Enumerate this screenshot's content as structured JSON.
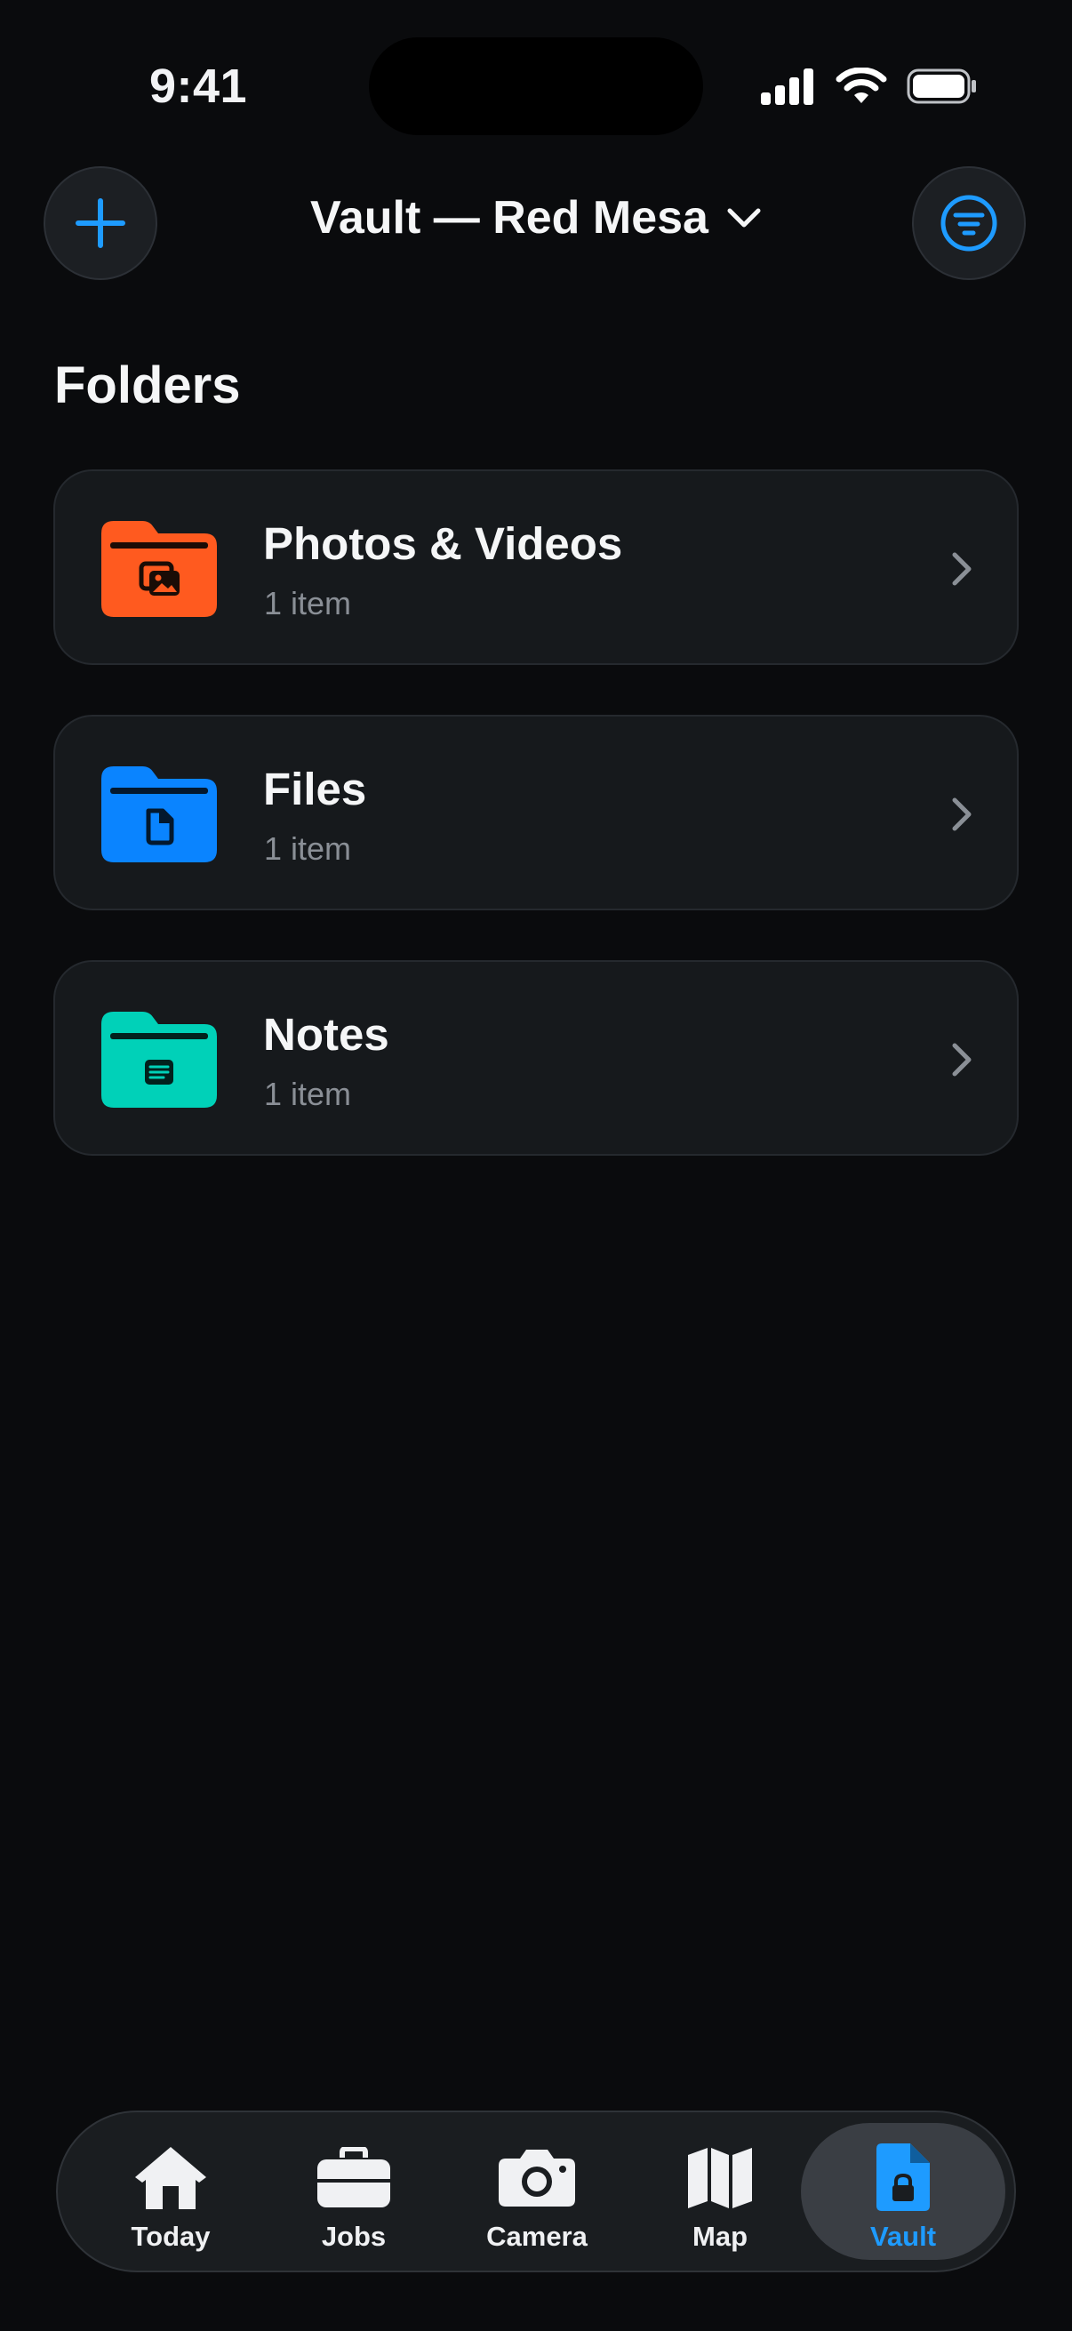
{
  "status_bar": {
    "time": "9:41"
  },
  "header": {
    "title": "Vault — Red Mesa",
    "add_icon": "plus-icon",
    "filter_icon": "filter-icon",
    "accent_color": "#1e9bff"
  },
  "section": {
    "title": "Folders"
  },
  "folders": [
    {
      "name": "Photos & Videos",
      "count": "1 item",
      "color": "#ff5a1f",
      "icon": "photos-icon"
    },
    {
      "name": "Files",
      "count": "1 item",
      "color": "#0a84ff",
      "icon": "document-icon"
    },
    {
      "name": "Notes",
      "count": "1 item",
      "color": "#00d1b8",
      "icon": "note-icon"
    }
  ],
  "tab_bar": {
    "active": "Vault",
    "tabs": [
      {
        "label": "Today",
        "icon": "house-icon"
      },
      {
        "label": "Jobs",
        "icon": "briefcase-icon"
      },
      {
        "label": "Camera",
        "icon": "camera-icon"
      },
      {
        "label": "Map",
        "icon": "map-icon"
      },
      {
        "label": "Vault",
        "icon": "locked-document-icon"
      }
    ]
  }
}
